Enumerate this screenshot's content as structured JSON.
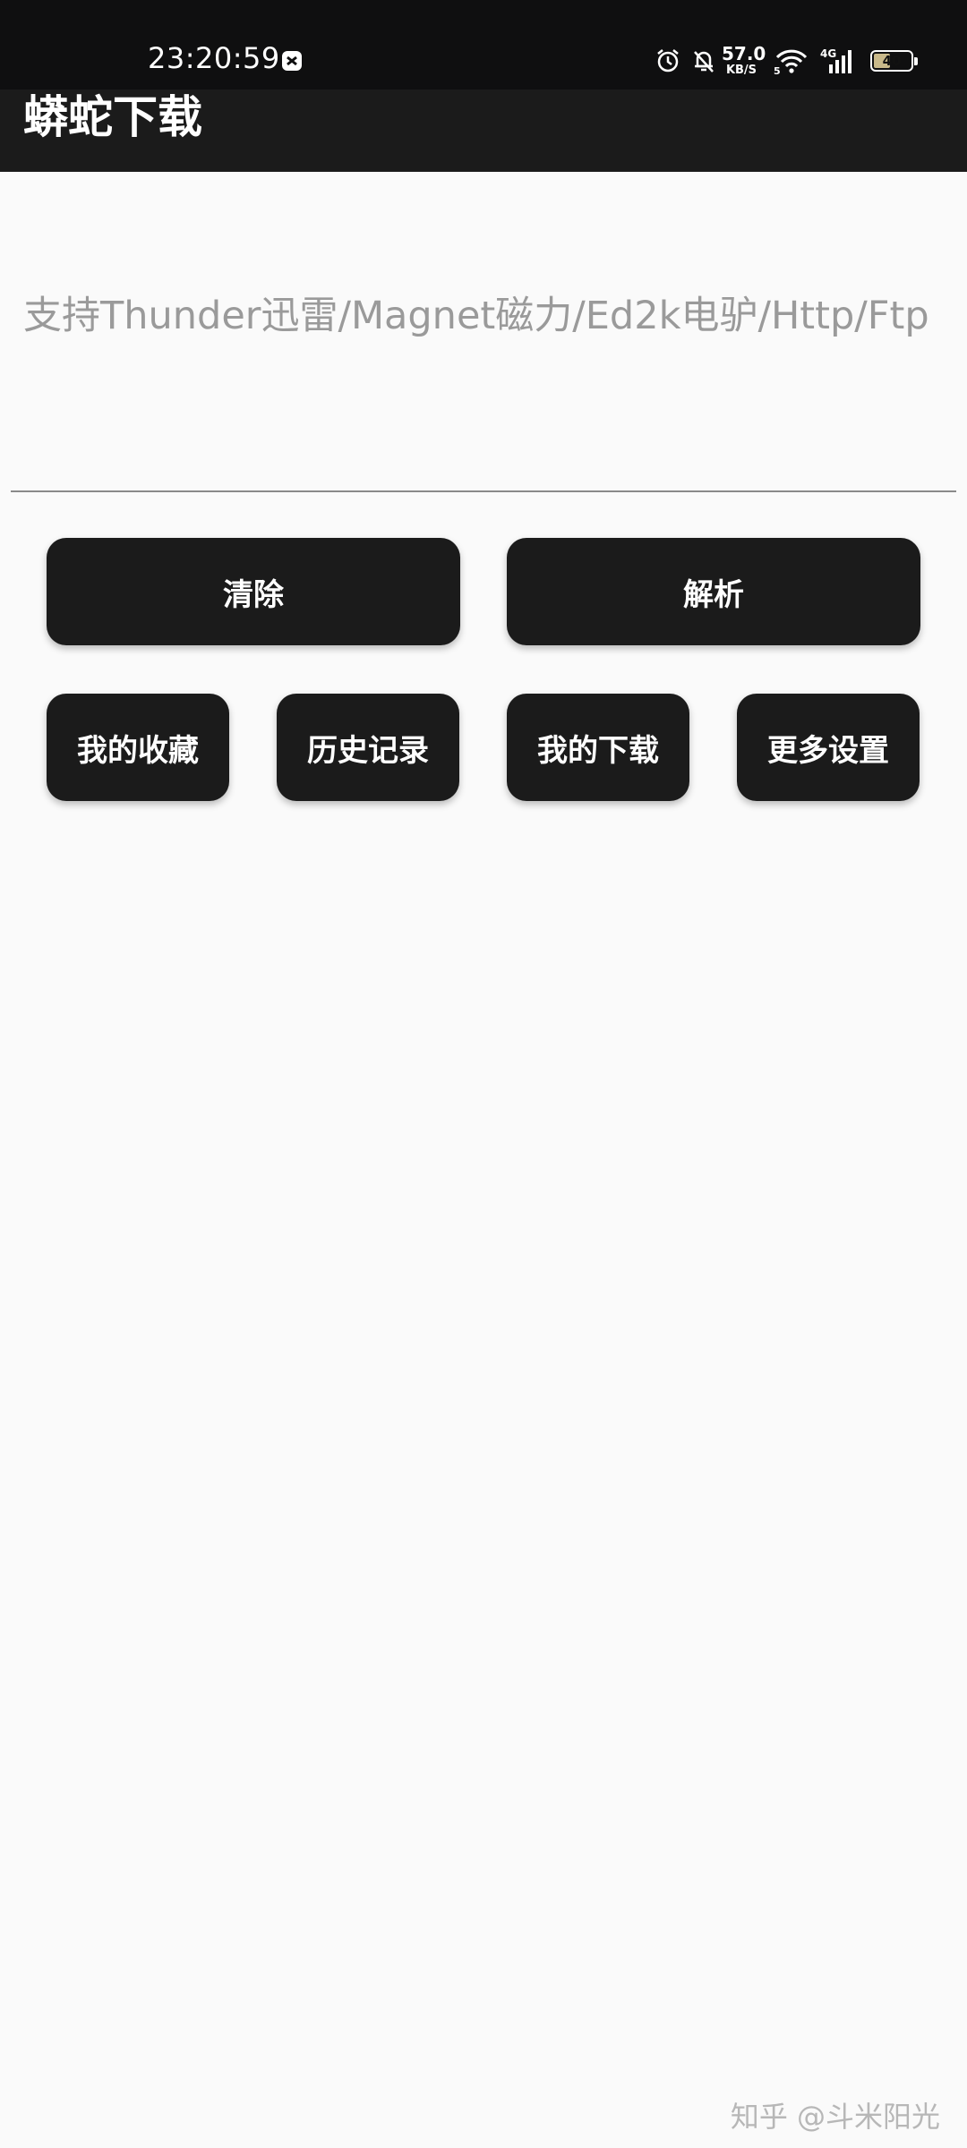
{
  "status_bar": {
    "time": "23:20:59",
    "notification_icon": "app-notification-icon",
    "icons": [
      "alarm-icon",
      "mute-bell-icon",
      "wifi-icon",
      "signal-4g-icon"
    ],
    "net_speed_value": "57.0",
    "net_speed_unit": "KB/S",
    "wifi_badge": "5",
    "signal_label": "4G",
    "battery_level": "40"
  },
  "app_bar": {
    "title": "蟒蛇下载"
  },
  "link_input": {
    "placeholder": "支持Thunder迅雷/Magnet磁力/Ed2k电驴/Http/Ftp",
    "value": ""
  },
  "actions": {
    "clear_label": "清除",
    "parse_label": "解析"
  },
  "menu": {
    "favorites_label": "我的收藏",
    "history_label": "历史记录",
    "downloads_label": "我的下载",
    "settings_label": "更多设置"
  },
  "watermark": "知乎 @斗米阳光",
  "colors": {
    "status_bar_bg": "#0f0f10",
    "app_bar_bg": "#1b1b1b",
    "button_bg": "#1b1b1b",
    "page_bg": "#fafafa"
  }
}
